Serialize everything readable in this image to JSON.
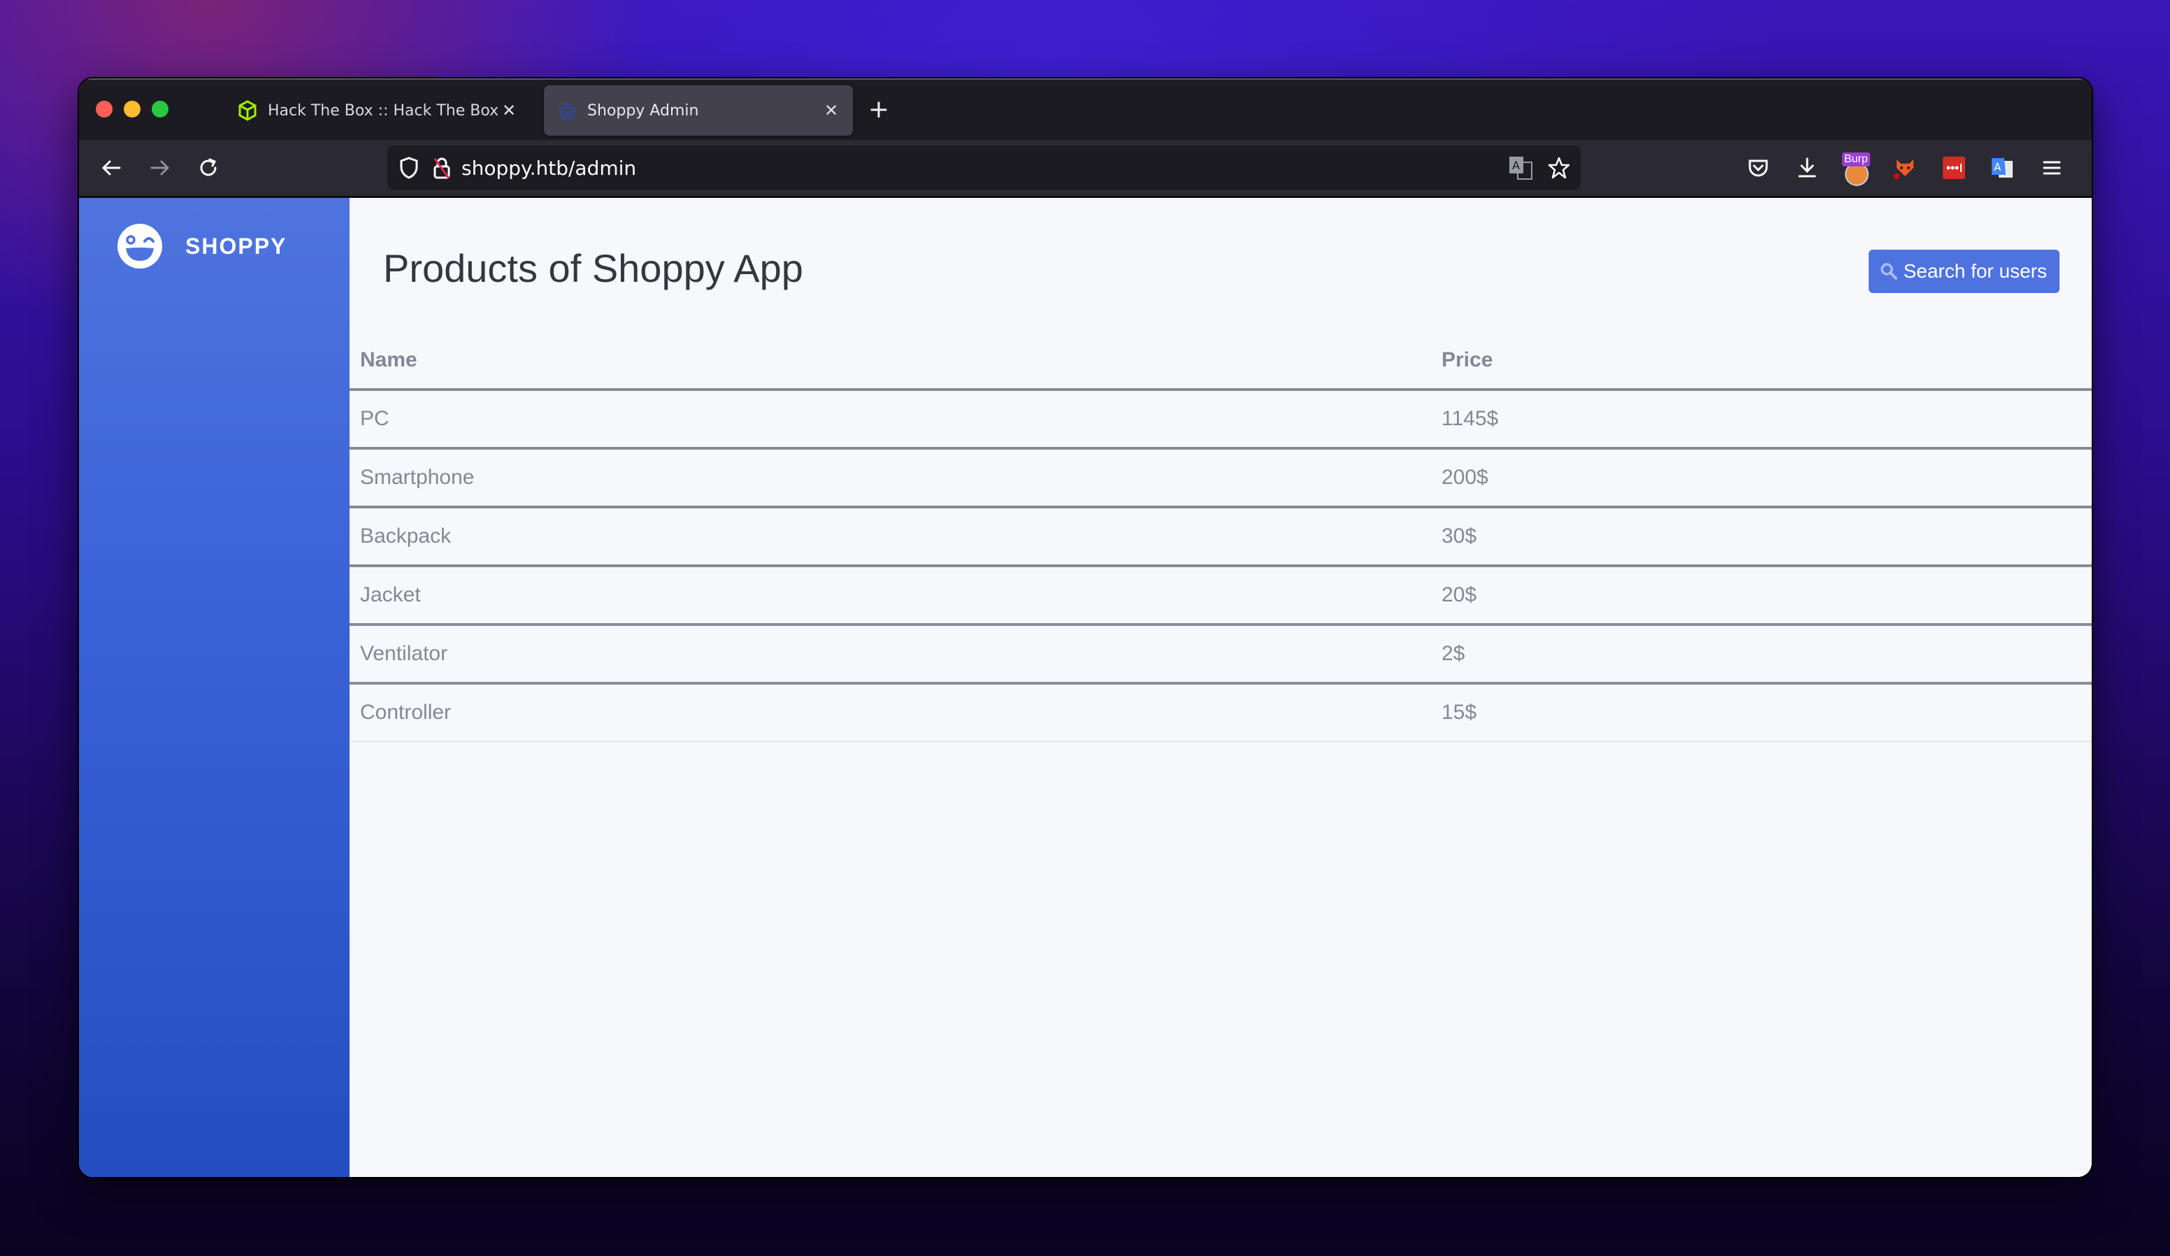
{
  "browser": {
    "tabs": [
      {
        "label": "Hack The Box :: Hack The Box",
        "favicon": "htb-cube-icon",
        "active": false
      },
      {
        "label": "Shoppy Admin",
        "favicon": "basket-icon",
        "active": true
      }
    ],
    "url": "shoppy.htb/admin",
    "toolbar_icons": [
      "back-icon",
      "forward-icon",
      "reload-icon",
      "shield-icon",
      "insecure-lock-icon",
      "translate-icon",
      "bookmark-star-icon",
      "pocket-icon",
      "download-icon",
      "burp-extension-icon",
      "foxyproxy-icon",
      "lastpass-icon",
      "google-translate-icon",
      "menu-icon"
    ],
    "burp_label": "Burp"
  },
  "sidebar": {
    "brand_name": "SHOPPY",
    "brand_color": "#4e73df"
  },
  "main": {
    "title": "Products of Shoppy App",
    "search_button_label": "Search for users",
    "table": {
      "headers": [
        "Name",
        "Price"
      ],
      "rows": [
        {
          "name": "PC",
          "price": "1145$"
        },
        {
          "name": "Smartphone",
          "price": "200$"
        },
        {
          "name": "Backpack",
          "price": "30$"
        },
        {
          "name": "Jacket",
          "price": "20$"
        },
        {
          "name": "Ventilator",
          "price": "2$"
        },
        {
          "name": "Controller",
          "price": "15$"
        }
      ]
    }
  }
}
